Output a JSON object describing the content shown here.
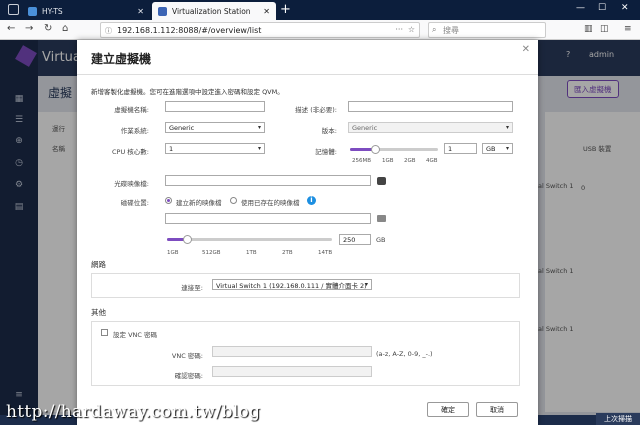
{
  "browser": {
    "tabs": [
      {
        "title": "HY-TS"
      },
      {
        "title": "Virtualization Station"
      }
    ],
    "url": "192.168.1.112:8088/#/overview/list",
    "search_placeholder": "搜尋"
  },
  "app": {
    "title": "Virtual",
    "page_heading": "虛擬",
    "user": "admin",
    "import_button": "匯入虛擬機",
    "col_name": "名稱",
    "col_usb": "USB 裝置",
    "status_label": "運行",
    "switch_text": "al Switch 1",
    "count": "0",
    "prev_page": "上次掃描"
  },
  "modal": {
    "title": "建立虛擬機",
    "description": "新增客製化虛擬機。您可在進階選項中設定進入密碼和設定 QVM。",
    "fields": {
      "vm_name_label": "虛擬機名稱:",
      "vm_name_value": "",
      "desc_label": "描述 (非必要):",
      "desc_value": "",
      "os_label": "作業系統:",
      "os_value": "Generic",
      "version_label": "版本:",
      "version_value": "Generic",
      "cpu_label": "CPU 核心數:",
      "cpu_value": "1",
      "memory_label": "記憶體:",
      "memory_value": "1",
      "memory_unit": "GB",
      "memory_ticks": [
        "256MB",
        "1GB",
        "2GB",
        "4GB"
      ],
      "cdrom_label": "光碟映像檔:",
      "cdrom_value": "",
      "disk_location_label": "磁碟位置:",
      "disk_new_label": "建立新的映像檔",
      "disk_existing_label": "使用已存在的映像檔",
      "disk_path_value": "",
      "disk_size_value": "250",
      "disk_size_unit": "GB",
      "disk_ticks": [
        "1GB",
        "512GB",
        "1TB",
        "2TB",
        "14TB"
      ]
    },
    "network": {
      "section_title": "網路",
      "connect_label": "連接至:",
      "connect_value": "Virtual Switch 1 (192.168.0.111 / 實體介面卡 2)"
    },
    "other": {
      "section_title": "其他",
      "vnc_checkbox_label": "設定 VNC 密碼",
      "vnc_password_label": "VNC 密碼:",
      "vnc_hint": "(a-z, A-Z, 0-9, _-.)",
      "confirm_password_label": "確認密碼:"
    },
    "buttons": {
      "ok": "確定",
      "cancel": "取消"
    },
    "memory_level_fraction": 0.28,
    "disk_level_fraction": 0.12
  },
  "watermark": "http://hardaway.com.tw/blog",
  "colors": {
    "accent": "#7d4cc0",
    "app_header": "#2a3b5c",
    "tabbar": "#0c1e3c",
    "info": "#1d8fe1"
  }
}
